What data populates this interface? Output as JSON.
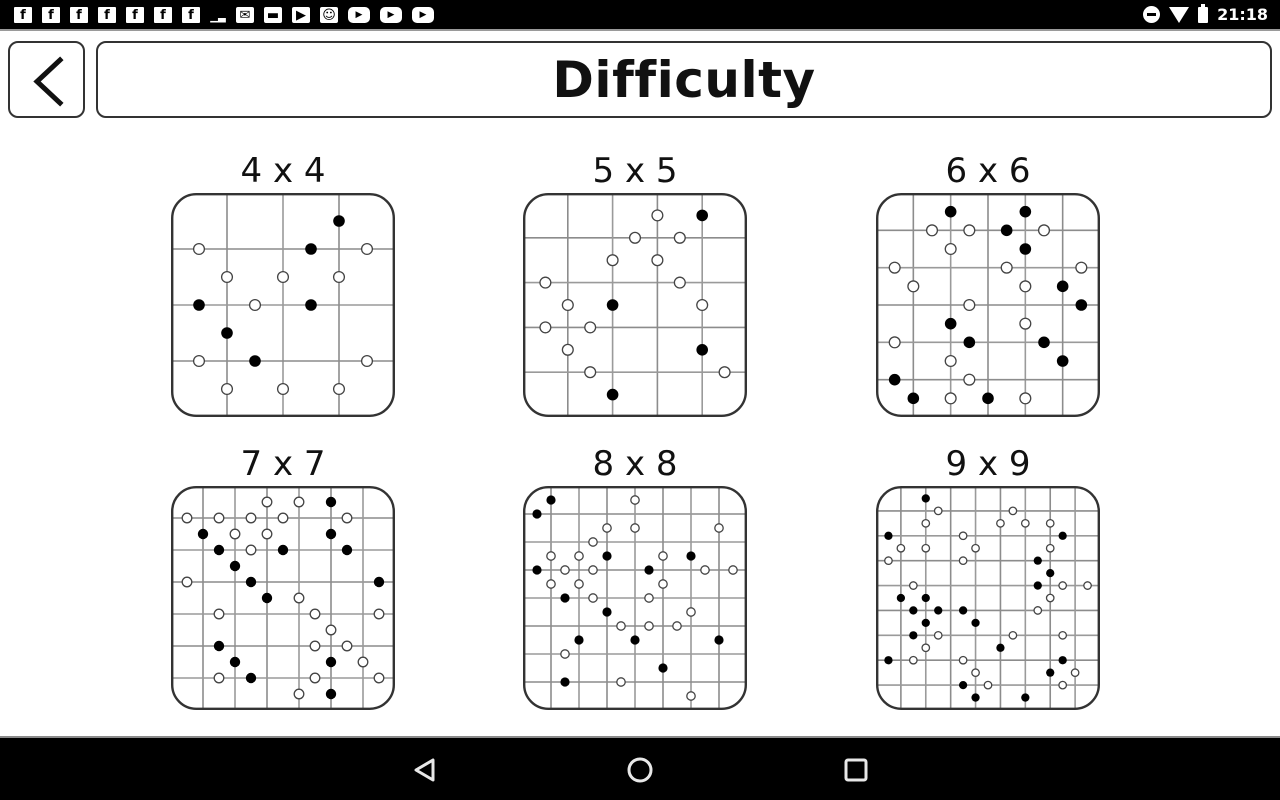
{
  "status_bar": {
    "left_icons": [
      "facebook-icon",
      "facebook-icon",
      "facebook-icon",
      "facebook-icon",
      "facebook-icon",
      "facebook-icon",
      "facebook-icon",
      "chart-icon",
      "mail-icon",
      "message-icon",
      "play-store-icon",
      "android-icon",
      "youtube-icon",
      "youtube-icon",
      "youtube-icon"
    ],
    "right_icons": [
      "do-not-disturb-icon",
      "wifi-icon",
      "battery-icon"
    ],
    "time": "21:18"
  },
  "header": {
    "back_icon": "chevron-left-icon",
    "title": "Difficulty"
  },
  "colors": {
    "background": "#ffffff",
    "border": "#333333",
    "grid_line": "#8c8c8c",
    "dot_black": "#000000",
    "dot_white": "#ffffff",
    "bar": "#000000"
  },
  "levels": [
    {
      "label": "4 x 4",
      "size": 4,
      "black": [
        [
          6,
          1
        ],
        [
          5,
          2
        ],
        [
          1,
          4
        ],
        [
          5,
          4
        ],
        [
          2,
          5
        ],
        [
          3,
          6
        ]
      ],
      "white": [
        [
          1,
          2
        ],
        [
          7,
          2
        ],
        [
          2,
          3
        ],
        [
          4,
          3
        ],
        [
          6,
          3
        ],
        [
          3,
          4
        ],
        [
          1,
          6
        ],
        [
          7,
          6
        ],
        [
          2,
          7
        ],
        [
          4,
          7
        ],
        [
          6,
          7
        ]
      ]
    },
    {
      "label": "5 x 5",
      "size": 5,
      "black": [
        [
          8,
          1
        ],
        [
          4,
          5
        ],
        [
          8,
          7
        ],
        [
          4,
          9
        ]
      ],
      "white": [
        [
          6,
          1
        ],
        [
          5,
          2
        ],
        [
          7,
          2
        ],
        [
          4,
          3
        ],
        [
          6,
          3
        ],
        [
          1,
          4
        ],
        [
          7,
          4
        ],
        [
          2,
          5
        ],
        [
          8,
          5
        ],
        [
          1,
          6
        ],
        [
          3,
          6
        ],
        [
          2,
          7
        ],
        [
          3,
          8
        ],
        [
          9,
          8
        ]
      ]
    },
    {
      "label": "6 x 6",
      "size": 6,
      "black": [
        [
          4,
          1
        ],
        [
          8,
          1
        ],
        [
          7,
          2
        ],
        [
          8,
          3
        ],
        [
          10,
          5
        ],
        [
          11,
          6
        ],
        [
          4,
          7
        ],
        [
          5,
          8
        ],
        [
          9,
          8
        ],
        [
          10,
          9
        ],
        [
          1,
          10
        ],
        [
          2,
          11
        ],
        [
          6,
          11
        ]
      ],
      "white": [
        [
          3,
          2
        ],
        [
          5,
          2
        ],
        [
          9,
          2
        ],
        [
          4,
          3
        ],
        [
          1,
          4
        ],
        [
          7,
          4
        ],
        [
          11,
          4
        ],
        [
          2,
          5
        ],
        [
          8,
          5
        ],
        [
          5,
          6
        ],
        [
          8,
          7
        ],
        [
          1,
          8
        ],
        [
          4,
          9
        ],
        [
          5,
          10
        ],
        [
          4,
          11
        ],
        [
          8,
          11
        ]
      ]
    },
    {
      "label": "7 x 7",
      "size": 7,
      "black": [
        [
          10,
          1
        ],
        [
          2,
          3
        ],
        [
          10,
          3
        ],
        [
          3,
          4
        ],
        [
          7,
          4
        ],
        [
          11,
          4
        ],
        [
          4,
          5
        ],
        [
          5,
          6
        ],
        [
          13,
          6
        ],
        [
          6,
          7
        ],
        [
          3,
          10
        ],
        [
          4,
          11
        ],
        [
          10,
          11
        ],
        [
          5,
          12
        ],
        [
          10,
          13
        ]
      ],
      "white": [
        [
          6,
          1
        ],
        [
          8,
          1
        ],
        [
          1,
          2
        ],
        [
          3,
          2
        ],
        [
          5,
          2
        ],
        [
          7,
          2
        ],
        [
          11,
          2
        ],
        [
          4,
          3
        ],
        [
          6,
          3
        ],
        [
          5,
          4
        ],
        [
          1,
          6
        ],
        [
          8,
          7
        ],
        [
          3,
          8
        ],
        [
          9,
          8
        ],
        [
          13,
          8
        ],
        [
          10,
          9
        ],
        [
          9,
          10
        ],
        [
          11,
          10
        ],
        [
          12,
          11
        ],
        [
          3,
          12
        ],
        [
          9,
          12
        ],
        [
          13,
          12
        ],
        [
          8,
          13
        ]
      ]
    },
    {
      "label": "8 x 8",
      "size": 8,
      "black": [
        [
          2,
          1
        ],
        [
          1,
          2
        ],
        [
          6,
          5
        ],
        [
          12,
          5
        ],
        [
          1,
          6
        ],
        [
          9,
          6
        ],
        [
          3,
          8
        ],
        [
          6,
          9
        ],
        [
          4,
          11
        ],
        [
          8,
          11
        ],
        [
          14,
          11
        ],
        [
          10,
          13
        ],
        [
          3,
          14
        ]
      ],
      "white": [
        [
          8,
          1
        ],
        [
          6,
          3
        ],
        [
          8,
          3
        ],
        [
          14,
          3
        ],
        [
          5,
          4
        ],
        [
          2,
          5
        ],
        [
          4,
          5
        ],
        [
          10,
          5
        ],
        [
          3,
          6
        ],
        [
          5,
          6
        ],
        [
          13,
          6
        ],
        [
          15,
          6
        ],
        [
          2,
          7
        ],
        [
          4,
          7
        ],
        [
          10,
          7
        ],
        [
          5,
          8
        ],
        [
          9,
          8
        ],
        [
          12,
          9
        ],
        [
          7,
          10
        ],
        [
          9,
          10
        ],
        [
          11,
          10
        ],
        [
          3,
          12
        ],
        [
          7,
          14
        ],
        [
          12,
          15
        ]
      ]
    },
    {
      "label": "9 x 9",
      "size": 9,
      "black": [
        [
          4,
          1
        ],
        [
          1,
          4
        ],
        [
          15,
          4
        ],
        [
          13,
          6
        ],
        [
          14,
          7
        ],
        [
          13,
          8
        ],
        [
          2,
          9
        ],
        [
          4,
          9
        ],
        [
          3,
          10
        ],
        [
          5,
          10
        ],
        [
          7,
          10
        ],
        [
          4,
          11
        ],
        [
          8,
          11
        ],
        [
          3,
          12
        ],
        [
          10,
          13
        ],
        [
          1,
          14
        ],
        [
          15,
          14
        ],
        [
          14,
          15
        ],
        [
          7,
          16
        ],
        [
          8,
          17
        ],
        [
          12,
          17
        ]
      ],
      "white": [
        [
          5,
          2
        ],
        [
          11,
          2
        ],
        [
          4,
          3
        ],
        [
          10,
          3
        ],
        [
          12,
          3
        ],
        [
          14,
          3
        ],
        [
          7,
          4
        ],
        [
          2,
          5
        ],
        [
          4,
          5
        ],
        [
          8,
          5
        ],
        [
          14,
          5
        ],
        [
          1,
          6
        ],
        [
          7,
          6
        ],
        [
          3,
          8
        ],
        [
          15,
          8
        ],
        [
          17,
          8
        ],
        [
          14,
          9
        ],
        [
          13,
          10
        ],
        [
          5,
          12
        ],
        [
          11,
          12
        ],
        [
          15,
          12
        ],
        [
          4,
          13
        ],
        [
          3,
          14
        ],
        [
          7,
          14
        ],
        [
          8,
          15
        ],
        [
          16,
          15
        ],
        [
          9,
          16
        ],
        [
          15,
          16
        ]
      ]
    }
  ],
  "nav_bar": {
    "back_icon": "nav-back-icon",
    "home_icon": "nav-home-icon",
    "recents_icon": "nav-recents-icon"
  }
}
